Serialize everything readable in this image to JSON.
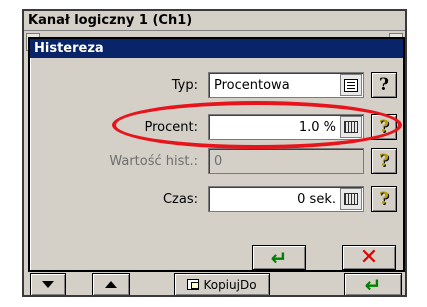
{
  "background_window": {
    "title": "Kanał logiczny 1 (Ch1)",
    "toolbar": {
      "down_icon": "arrow-down-icon",
      "up_icon": "arrow-up-icon",
      "copy_label": "KopiujDo",
      "ok_symbol": "↵"
    }
  },
  "dialog": {
    "title": "Histereza",
    "fields": {
      "typ": {
        "label": "Typ:",
        "value": "Procentowa"
      },
      "procent": {
        "label": "Procent:",
        "value": "1.0 %"
      },
      "wartosc": {
        "label": "Wartość hist.:",
        "value": "0"
      },
      "czas": {
        "label": "Czas:",
        "value": "0 sek."
      }
    },
    "help_symbol": "?",
    "ok_symbol": "↵",
    "cancel_symbol": "✕"
  },
  "colors": {
    "title_bar": "#0a246a",
    "highlight_ring": "#e8141c",
    "ok": "#008000",
    "cancel": "#e00000"
  }
}
